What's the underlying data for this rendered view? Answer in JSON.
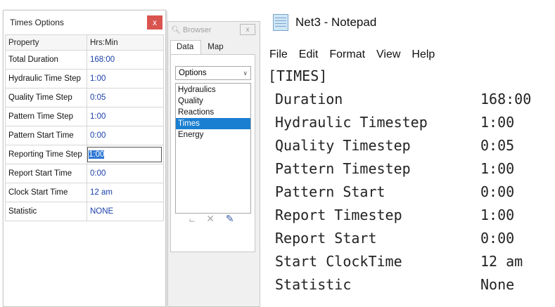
{
  "times_options": {
    "title": "Times Options",
    "close_label": "x",
    "columns": [
      "Property",
      "Hrs:Min"
    ],
    "rows": [
      {
        "property": "Total Duration",
        "value": "168:00"
      },
      {
        "property": "Hydraulic Time Step",
        "value": "1:00"
      },
      {
        "property": "Quality Time Step",
        "value": "0:05"
      },
      {
        "property": "Pattern Time Step",
        "value": "1:00"
      },
      {
        "property": "Pattern Start Time",
        "value": "0:00"
      },
      {
        "property": "Reporting Time Step",
        "value": "1:00"
      },
      {
        "property": "Report Start Time",
        "value": "0:00"
      },
      {
        "property": "Clock Start Time",
        "value": "12 am"
      },
      {
        "property": "Statistic",
        "value": "NONE"
      }
    ]
  },
  "browser": {
    "title": "Browser",
    "close_label": "x",
    "tabs": [
      "Data",
      "Map"
    ],
    "select_value": "Options",
    "options": [
      "Hydraulics",
      "Quality",
      "Reactions",
      "Times",
      "Energy"
    ],
    "selected_option": "Times"
  },
  "notepad": {
    "title": "Net3 - Notepad",
    "menu": [
      "File",
      "Edit",
      "Format",
      "View",
      "Help"
    ],
    "section": "[TIMES]",
    "lines": [
      {
        "key": "Duration",
        "value": "168:00"
      },
      {
        "key": "Hydraulic Timestep",
        "value": "1:00"
      },
      {
        "key": "Quality Timestep",
        "value": "0:05"
      },
      {
        "key": "Pattern Timestep",
        "value": "1:00"
      },
      {
        "key": "Pattern Start",
        "value": "0:00"
      },
      {
        "key": "Report Timestep",
        "value": "1:00"
      },
      {
        "key": "Report Start",
        "value": "0:00"
      },
      {
        "key": "Start ClockTime",
        "value": "12 am"
      },
      {
        "key": "Statistic",
        "value": "None"
      }
    ]
  }
}
